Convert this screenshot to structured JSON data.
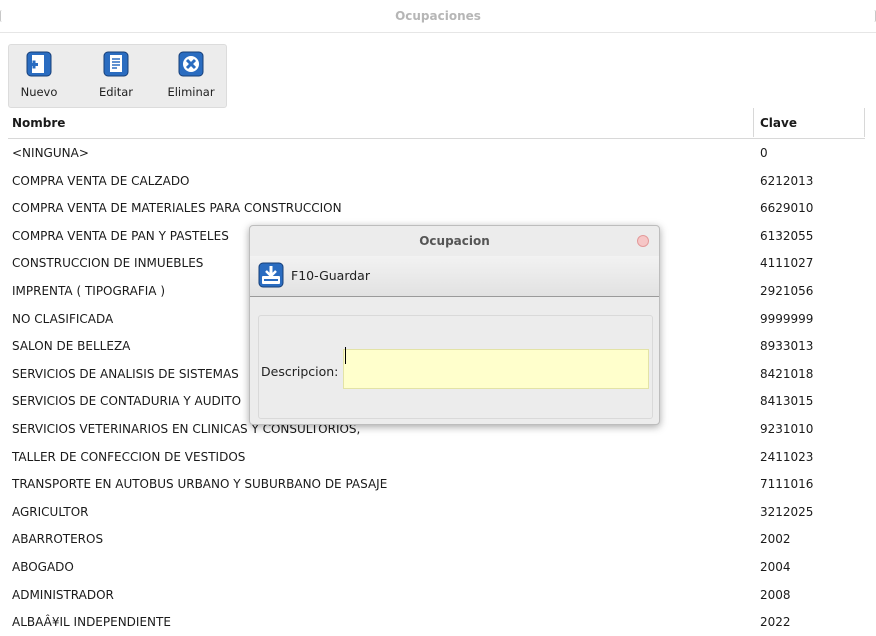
{
  "window": {
    "title": "Ocupaciones"
  },
  "toolbar": {
    "nuevo": "Nuevo",
    "editar": "Editar",
    "eliminar": "Eliminar"
  },
  "table": {
    "headers": {
      "nombre": "Nombre",
      "clave": "Clave"
    },
    "rows": [
      {
        "nombre": "<NINGUNA>",
        "clave": "0"
      },
      {
        "nombre": "COMPRA VENTA DE CALZADO",
        "clave": "6212013"
      },
      {
        "nombre": "COMPRA VENTA DE MATERIALES PARA CONSTRUCCION",
        "clave": "6629010"
      },
      {
        "nombre": "COMPRA VENTA DE PAN Y PASTELES",
        "clave": "6132055"
      },
      {
        "nombre": "CONSTRUCCION DE INMUEBLES",
        "clave": "4111027"
      },
      {
        "nombre": "IMPRENTA ( TIPOGRAFIA )",
        "clave": "2921056"
      },
      {
        "nombre": "NO CLASIFICADA",
        "clave": "9999999"
      },
      {
        "nombre": "SALON DE BELLEZA",
        "clave": "8933013"
      },
      {
        "nombre": "SERVICIOS DE ANALISIS DE SISTEMAS",
        "clave": "8421018"
      },
      {
        "nombre": "SERVICIOS DE CONTADURIA Y AUDITO",
        "clave": "8413015"
      },
      {
        "nombre": "SERVICIOS VETERINARIOS EN CLINICAS Y CONSULTORIOS,",
        "clave": "9231010"
      },
      {
        "nombre": "TALLER DE CONFECCION DE VESTIDOS",
        "clave": "2411023"
      },
      {
        "nombre": "TRANSPORTE EN AUTOBUS URBANO Y SUBURBANO DE PASAJE",
        "clave": "7111016"
      },
      {
        "nombre": "AGRICULTOR",
        "clave": "3212025"
      },
      {
        "nombre": "ABARROTEROS",
        "clave": "2002"
      },
      {
        "nombre": "ABOGADO",
        "clave": "2004"
      },
      {
        "nombre": "ADMINISTRADOR",
        "clave": "2008"
      },
      {
        "nombre": "ALBAÂ¥IL INDEPENDIENTE",
        "clave": "2022"
      }
    ]
  },
  "dialog": {
    "title": "Ocupacion",
    "save_label": "F10-Guardar",
    "descripcion_label": "Descripcion:",
    "descripcion_value": ""
  },
  "colors": {
    "field_bg": "#ffffcc",
    "close_button": "#f6c6c6",
    "icon_blue": "#1f5fb0"
  }
}
